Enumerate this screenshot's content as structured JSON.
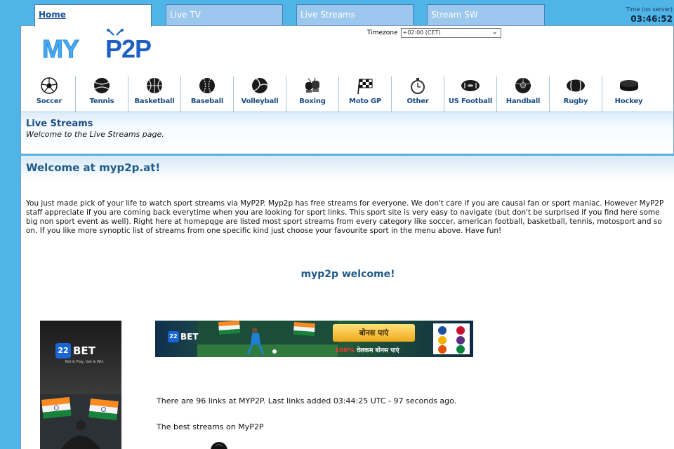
{
  "tabs": [
    {
      "label": "Home",
      "active": true
    },
    {
      "label": "Live TV",
      "active": false
    },
    {
      "label": "Live Streams",
      "active": false
    },
    {
      "label": "Stream SW",
      "active": false
    }
  ],
  "server_time": {
    "label": "Time (on server)",
    "value": "03:46:52"
  },
  "logo": {
    "text_left": "MY",
    "text_right": "P2P"
  },
  "timezone": {
    "label": "Timezone",
    "selected": "+02:00 (CET)"
  },
  "sports": [
    {
      "label": "Soccer",
      "icon": "soccer-ball-icon"
    },
    {
      "label": "Tennis",
      "icon": "tennis-ball-icon"
    },
    {
      "label": "Basketball",
      "icon": "basketball-icon"
    },
    {
      "label": "Baseball",
      "icon": "baseball-icon"
    },
    {
      "label": "Volleyball",
      "icon": "volleyball-icon"
    },
    {
      "label": "Boxing",
      "icon": "boxing-gloves-icon"
    },
    {
      "label": "Moto GP",
      "icon": "checkered-flag-icon"
    },
    {
      "label": "Other",
      "icon": "stopwatch-icon"
    },
    {
      "label": "US Football",
      "icon": "american-football-icon"
    },
    {
      "label": "Handball",
      "icon": "handball-icon"
    },
    {
      "label": "Rugby",
      "icon": "rugby-ball-icon"
    },
    {
      "label": "Hockey",
      "icon": "hockey-puck-icon"
    }
  ],
  "page_header": {
    "title": "Live Streams",
    "subtitle": "Welcome to the Live Streams page."
  },
  "main": {
    "title": "Welcome at myp2p.at!",
    "intro": "You just made pick of your life to watch sport streams via MyP2P. Myp2p has free streams for everyone. We don't care if you are causal fan or sport maniac. However MyP2P staff appreciate if you are coming back everytime when you are looking for sport links. This sport site is very easy to navigate (but don't be surprised if you find here some big non sport event as well). Right here at homepqge are listed most sport streams from every category like soccer, american football, basketball, tennis, motosport and so on. If you like more synoptic list of streams from one specific kind just choose your favourite sport in the menu above. Have fun!",
    "subtitle": "myp2p welcome!",
    "links_info": "There are 96 links at MYP2P. Last links added 03:44:25 UTC - 97 seconds ago.",
    "best_streams": "The best streams on MyP2P"
  },
  "ads": {
    "side": {
      "brand": "BET",
      "mark": "22",
      "tagline": "Bet & Play, Get & Win"
    },
    "banner": {
      "brand": "BET",
      "mark": "22",
      "button": "बोनस पाएं",
      "caption_pct": "100%",
      "caption_text": " वेलकम बोनस पाएं"
    }
  },
  "colors": {
    "background": "#4fb4e8",
    "tab_inactive": "#9cc7ee",
    "link_blue": "#1b4b83",
    "logo_blue": "#2a8de0"
  }
}
